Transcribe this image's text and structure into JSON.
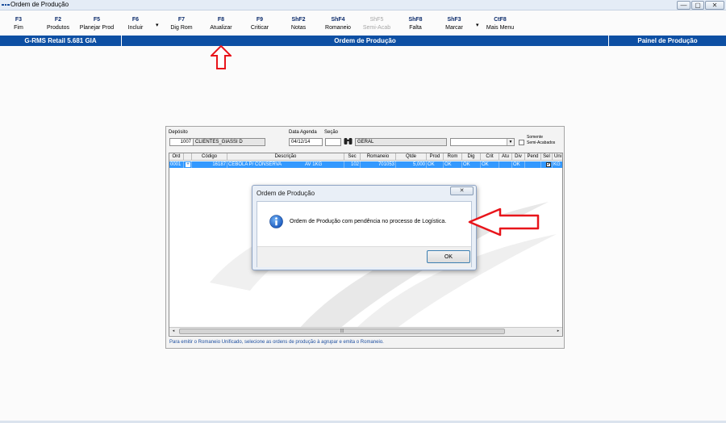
{
  "window": {
    "title": "Ordem de Produção",
    "minimize": "—",
    "maximize": "▢",
    "close": "✕"
  },
  "toolbar": [
    {
      "key": "F3",
      "label": "Fim"
    },
    {
      "key": "F2",
      "label": "Produtos"
    },
    {
      "key": "F5",
      "label": "Planejar Prod"
    },
    {
      "key": "F6",
      "label": "Incluir"
    },
    {
      "key": "F7",
      "label": "Dig Rom"
    },
    {
      "key": "F8",
      "label": "Atualizar"
    },
    {
      "key": "F9",
      "label": "Criticar"
    },
    {
      "key": "ShF2",
      "label": "Notas"
    },
    {
      "key": "ShF4",
      "label": "Romaneio"
    },
    {
      "key": "ShF5",
      "label": "Semi-Acab"
    },
    {
      "key": "ShF8",
      "label": "Falta"
    },
    {
      "key": "ShF3",
      "label": "Marcar"
    },
    {
      "key": "CtF8",
      "label": "Mais Menu"
    }
  ],
  "header": {
    "left": "G-RMS Retail 5.681 GIA",
    "center": "Ordem de Produção",
    "right": "Painel de Produção"
  },
  "form": {
    "deposito_label": "Depósito",
    "deposito_code": "1007",
    "deposito_name": "CLIENTES_GIASSI D",
    "data_agenda_label": "Data Agenda",
    "data_agenda": "04/12/14",
    "secao_label": "Seção",
    "secao_code": "",
    "secao_name": "GERAL",
    "combo_value": "",
    "somente_label": "Somente",
    "semi_label": "Semi-Acabados"
  },
  "grid": {
    "columns": [
      "Ord",
      "Código",
      "Descrição",
      "Sec",
      "Romaneio",
      "Qtde",
      "Prod",
      "Rom",
      "Dig",
      "Crit",
      "Atu",
      "Div",
      "Pend",
      "Sel",
      "Uni"
    ],
    "row": {
      "ord": "0001",
      "plus": "+",
      "codigo": "16187",
      "descricao": "CEBOLA P/ CONSERVA",
      "embalagem": "AV   1KG",
      "sec": "102",
      "romaneio": "701053",
      "qtde": "5,000",
      "prod": "OK",
      "rom": "OK",
      "dig": "OK",
      "crit": "OK",
      "atu": "",
      "div": "OK",
      "pend": "",
      "sel": "✔",
      "uni": "KG"
    },
    "scroll_grip": "|||"
  },
  "footer_note": "Para emitir o Romaneio Unificado, selecione as ordens de produção à agrupar e emita o Romaneio.",
  "dialog": {
    "title": "Ordem de Produção",
    "close": "✕",
    "message": "Ordem de Produção com pendência no processo de Logística.",
    "ok": "OK"
  },
  "colors": {
    "header_blue": "#0d4fa3",
    "selection_blue": "#3399ff",
    "annotation_red": "#e8151b"
  }
}
